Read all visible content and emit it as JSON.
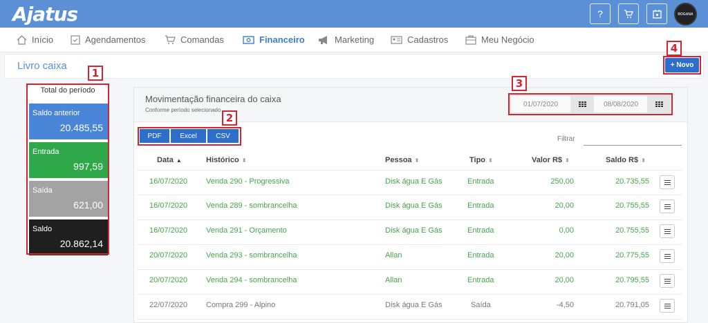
{
  "app": {
    "logo": "Ajatus",
    "avatar_text": "ROGANA"
  },
  "topbar": {
    "help_label": "?",
    "cart_icon": "cart-icon",
    "calendar_icon": "calendar-icon"
  },
  "nav": {
    "items": [
      {
        "label": "Início",
        "icon": "home-icon"
      },
      {
        "label": "Agendamentos",
        "icon": "clipboard-icon"
      },
      {
        "label": "Comandas",
        "icon": "cart-icon"
      },
      {
        "label": "Financeiro",
        "icon": "money-icon",
        "active": true
      },
      {
        "label": "Marketing",
        "icon": "megaphone-icon"
      },
      {
        "label": "Cadastros",
        "icon": "id-card-icon"
      },
      {
        "label": "Meu Negócio",
        "icon": "briefcase-icon"
      }
    ]
  },
  "page": {
    "title": "Livro caixa",
    "new_button": "+ Novo"
  },
  "summary": {
    "title": "Total do período",
    "items": [
      {
        "label": "Saldo anterior",
        "value": "20.485,55",
        "color": "#4a86d8"
      },
      {
        "label": "Entrada",
        "value": "997,59",
        "color": "#2fa84a"
      },
      {
        "label": "Saída",
        "value": "621,00",
        "color": "#a3a3a3"
      },
      {
        "label": "Saldo",
        "value": "20.862,14",
        "color": "#1f1f1f"
      }
    ]
  },
  "card": {
    "title": "Movimentação financeira do caixa",
    "subtitle": "Conforme período selecionado",
    "date_from": "01/07/2020",
    "date_to": "08/08/2020",
    "export": {
      "pdf": "PDF",
      "excel": "Excel",
      "csv": "CSV"
    },
    "filter_label": "Filtrar",
    "filter_value": ""
  },
  "table": {
    "columns": [
      "Data",
      "Histórico",
      "Pessoa",
      "Tipo",
      "Valor R$",
      "Saldo R$"
    ],
    "rows": [
      {
        "data": "16/07/2020",
        "historico": "Venda 290 - Progressiva",
        "pessoa": "Disk água E Gás",
        "tipo": "Entrada",
        "valor": "250,00",
        "saldo": "20.735,55",
        "status": "entrada"
      },
      {
        "data": "16/07/2020",
        "historico": "Venda 289 - sombrancelha",
        "pessoa": "Disk água E Gás",
        "tipo": "Entrada",
        "valor": "20,00",
        "saldo": "20.755,55",
        "status": "entrada"
      },
      {
        "data": "16/07/2020",
        "historico": "Venda 291 - Orçamento",
        "pessoa": "Disk água E Gás",
        "tipo": "Entrada",
        "valor": "0,00",
        "saldo": "20.755,55",
        "status": "entrada"
      },
      {
        "data": "20/07/2020",
        "historico": "Venda 293 - sombrancelha",
        "pessoa": "Allan",
        "tipo": "Entrada",
        "valor": "20,00",
        "saldo": "20.775,55",
        "status": "entrada"
      },
      {
        "data": "20/07/2020",
        "historico": "Venda 294 - sombrancelha",
        "pessoa": "Allan",
        "tipo": "Entrada",
        "valor": "20,00",
        "saldo": "20.795,55",
        "status": "entrada"
      },
      {
        "data": "22/07/2020",
        "historico": "Compra 299 - Alpino",
        "pessoa": "Disk água E Gás",
        "tipo": "Saída",
        "valor": "-4,50",
        "saldo": "20.791,05",
        "status": "saida"
      }
    ]
  },
  "annotations": [
    "1",
    "2",
    "3",
    "4"
  ],
  "colors": {
    "accent": "#5b8fd6",
    "button": "#2d6ecb",
    "entrada": "#45a44a",
    "annotation": "#d7232d"
  }
}
